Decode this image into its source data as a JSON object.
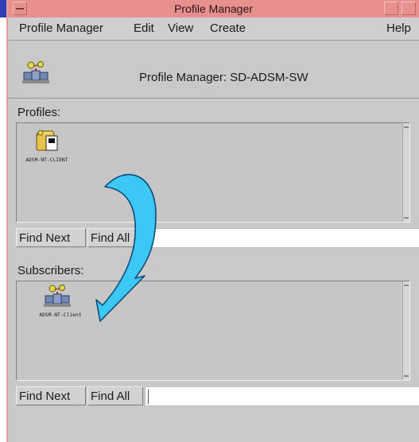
{
  "window": {
    "title": "Profile Manager"
  },
  "menu": {
    "profile_manager": "Profile Manager",
    "edit": "Edit",
    "view": "View",
    "create": "Create",
    "help": "Help"
  },
  "header": {
    "text": "Profile Manager: SD-ADSM-SW",
    "icon": "profile-manager-icon"
  },
  "profiles": {
    "label": "Profiles:",
    "items": [
      {
        "label": "ADSM-NT-CLIENT",
        "icon": "profile-icon"
      }
    ],
    "find_next": "Find Next",
    "find_all": "Find All",
    "search_value": ""
  },
  "subscribers": {
    "label": "Subscribers:",
    "items": [
      {
        "label": "ADSM-NT-Client",
        "icon": "subscriber-icon"
      }
    ],
    "find_next": "Find Next",
    "find_all": "Find All",
    "search_value": ""
  },
  "colors": {
    "titlebar": "#e88f8f",
    "window_bg": "#c9c9c9",
    "arrow": "#3cc8f5",
    "accent_edge": "#2f3fb8"
  }
}
